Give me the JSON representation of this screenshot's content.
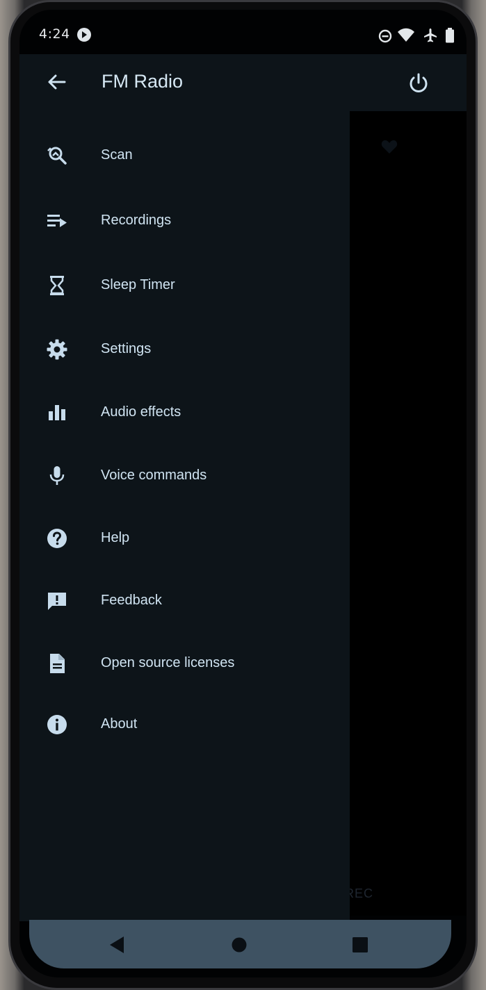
{
  "status_bar": {
    "time": "4:24",
    "icons": [
      "media-icon",
      "do-not-disturb-icon",
      "wifi-icon",
      "airplane-mode-icon",
      "battery-icon"
    ]
  },
  "app_bar": {
    "title": "FM Radio",
    "back_icon": "arrow-back-icon",
    "power_icon": "power-icon"
  },
  "drawer": {
    "items": [
      {
        "label": "Scan",
        "icon": "scan-icon"
      },
      {
        "label": "Recordings",
        "icon": "recordings-icon"
      },
      {
        "label": "Sleep Timer",
        "icon": "hourglass-icon"
      },
      {
        "label": "Settings",
        "icon": "gear-icon"
      },
      {
        "label": "Audio effects",
        "icon": "equalizer-icon"
      },
      {
        "label": "Voice commands",
        "icon": "microphone-icon"
      },
      {
        "label": "Help",
        "icon": "help-icon"
      },
      {
        "label": "Feedback",
        "icon": "feedback-icon"
      },
      {
        "label": "Open source licenses",
        "icon": "document-icon"
      },
      {
        "label": "About",
        "icon": "info-icon"
      }
    ]
  },
  "background": {
    "rec_label": "REC"
  },
  "nav_bar": {
    "icons": [
      "back-triangle-icon",
      "home-circle-icon",
      "recents-square-icon"
    ]
  },
  "colors": {
    "drawer_bg": "#0d1419",
    "text": "#d0e4f2",
    "icon": "#c7dcec",
    "navbar_bg": "#3e5262"
  }
}
